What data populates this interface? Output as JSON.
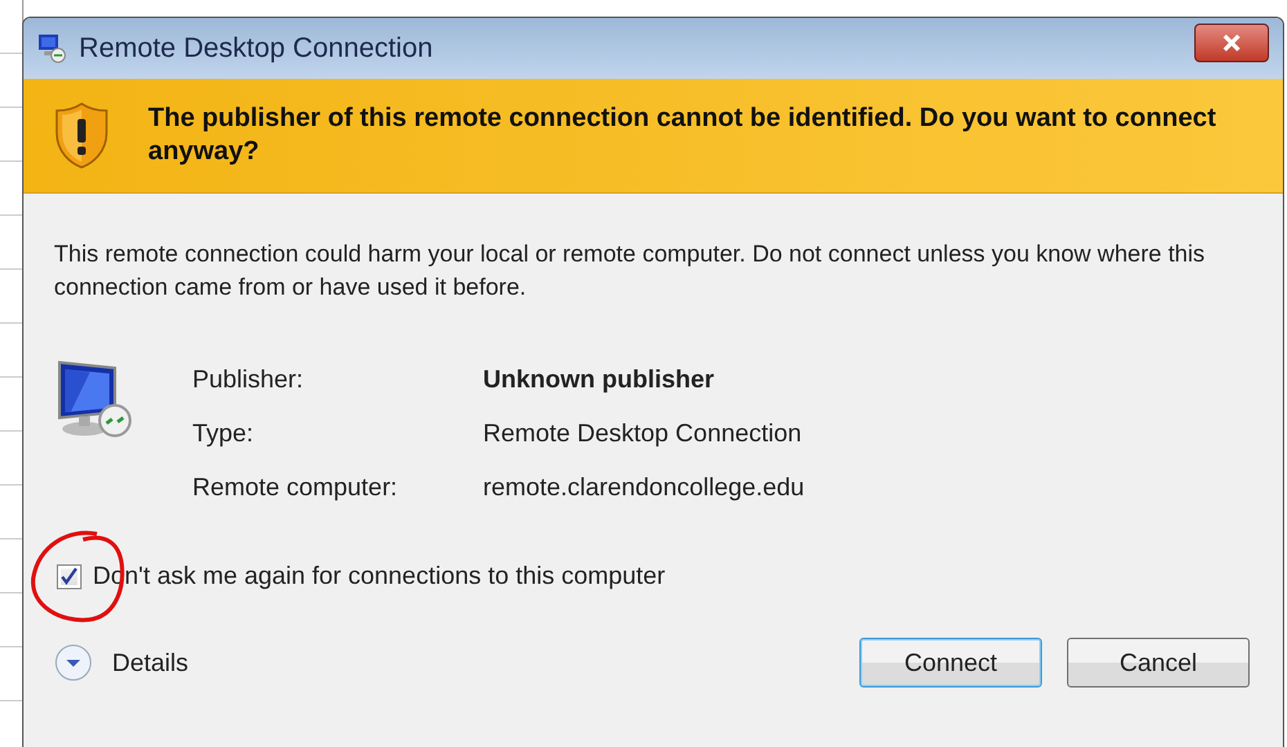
{
  "window": {
    "title": "Remote Desktop Connection"
  },
  "warning": {
    "heading": "The publisher of this remote connection cannot be identified. Do you want to connect anyway?"
  },
  "message": "This remote connection could harm your local or remote computer. Do not connect unless you know where this connection came from or have used it before.",
  "details": [
    {
      "label": "Publisher:",
      "value": "Unknown publisher",
      "emphasis": true
    },
    {
      "label": "Type:",
      "value": "Remote Desktop Connection",
      "emphasis": false
    },
    {
      "label": "Remote computer:",
      "value": "remote.clarendoncollege.edu",
      "emphasis": false
    }
  ],
  "dont_ask": {
    "label": "Don't ask me again for connections to this computer",
    "checked": true
  },
  "expander": {
    "label": "Details",
    "expanded": false
  },
  "buttons": [
    {
      "label": "Connect",
      "default": true
    },
    {
      "label": "Cancel",
      "default": false
    }
  ]
}
